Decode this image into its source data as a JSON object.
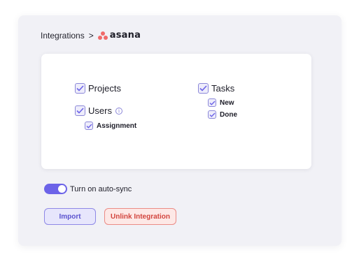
{
  "breadcrumb": {
    "root": "Integrations",
    "separator": ">",
    "integration_name": "asana"
  },
  "permissions": {
    "projects": {
      "label": "Projects",
      "checked": true
    },
    "users": {
      "label": "Users",
      "checked": true,
      "info_icon": "info-icon",
      "children": [
        {
          "label": "Assignment",
          "checked": true
        }
      ]
    },
    "tasks": {
      "label": "Tasks",
      "checked": true,
      "children": [
        {
          "label": "New",
          "checked": true
        },
        {
          "label": "Done",
          "checked": true
        }
      ]
    }
  },
  "auto_sync": {
    "label": "Turn on auto-sync",
    "enabled": true
  },
  "actions": {
    "import_label": "Import",
    "unlink_label": "Unlink Integration"
  },
  "colors": {
    "accent": "#6c63e8",
    "checkbox_border": "#8b87d8",
    "danger": "#d2453e",
    "asana_brand": "#f06a6a"
  }
}
